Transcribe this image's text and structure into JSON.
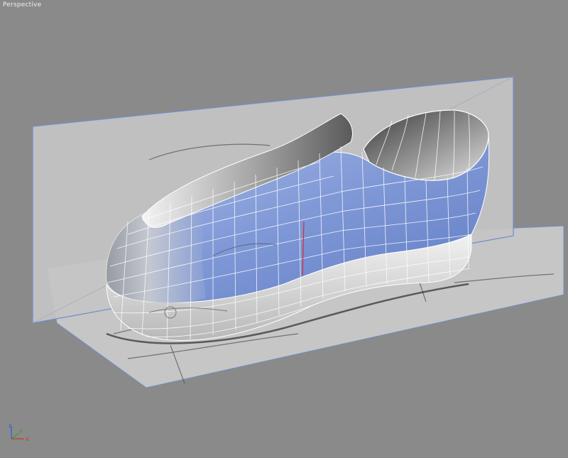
{
  "viewport": {
    "label": "Perspective",
    "background_color": "#8a8a8a"
  },
  "scene": {
    "object": "shoe-model",
    "upper_color": "#7f98d6",
    "sole_color": "#e6e6e6",
    "wireframe_color": "#ffffff",
    "reference_plane_color": "#c4c4c4",
    "selection_edge_color": "#6e8fc8"
  },
  "axis_gizmo": {
    "x_label": "x",
    "y_label": "y",
    "z_label": "z",
    "x_color": "#d23030",
    "y_color": "#2f9e2f",
    "z_color": "#2f5fd0"
  }
}
